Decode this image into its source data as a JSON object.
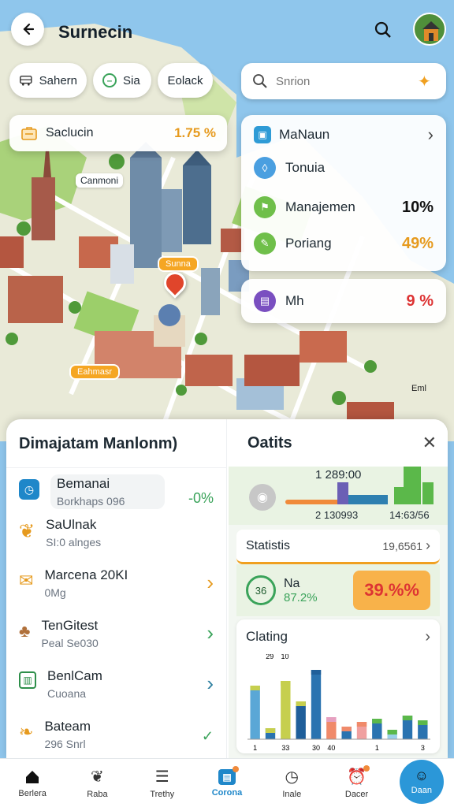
{
  "header": {
    "title": "Surnecin"
  },
  "filters": [
    {
      "label": "Sahern"
    },
    {
      "label": "Sia"
    },
    {
      "label": "Eolack"
    }
  ],
  "search": {
    "placeholder": "Snrion"
  },
  "stat_card": {
    "label": "Saclucin",
    "value": "1.75 %"
  },
  "map_labels": {
    "poi1": "Canmoni",
    "poi2": "Sunna",
    "poi3": "Eahmasr",
    "corner": "Eml"
  },
  "legend_panel": {
    "title": "MaNaun",
    "items": [
      {
        "label": "Tonuia",
        "value": "",
        "color": "#4a9fe0"
      },
      {
        "label": "Manajemen",
        "value": "10%",
        "color": "#6fbf4a"
      },
      {
        "label": "Poriang",
        "value": "49%",
        "color": "#6fbf4a"
      }
    ]
  },
  "mh_card": {
    "label": "Mh",
    "value": "9 %"
  },
  "sheet": {
    "title": "Dimajatam Manlonm)",
    "list": [
      {
        "title": "Bemanai",
        "subtitle": "Borkhaps 096",
        "trail": "-0%",
        "icon": "clock-icon"
      },
      {
        "title": "SaUlnak",
        "subtitle": "SI:0 alnges",
        "trail": "",
        "icon": "leaf-icon"
      },
      {
        "title": "Marcena 20KI",
        "subtitle": "0Mg",
        "trail": "›",
        "icon": "mail-icon"
      },
      {
        "title": "TenGitest",
        "subtitle": "Peal Se030",
        "trail": "›",
        "icon": "tree-icon"
      },
      {
        "title": "BenlCam",
        "subtitle": "Cuoana",
        "trail": "›",
        "icon": "doc-icon"
      },
      {
        "title": "Bateam",
        "subtitle": "296 Snrl",
        "trail": "✓",
        "icon": "leaf-icon"
      }
    ]
  },
  "stats_panel": {
    "title": "Oatits",
    "mini_top": "1 289:00",
    "mini_left": "2 130993",
    "mini_right": "14:63/56",
    "statistics_label": "Statistis",
    "statistics_value": "19,6561",
    "na_label": "Na",
    "na_badge": "36",
    "na_value": "87.2%",
    "big_value": "39.%%",
    "chart_title": "Clating",
    "chart_small_labels": [
      "29",
      "10"
    ]
  },
  "chart_data": {
    "type": "bar",
    "categories": [
      "1",
      "",
      "33",
      "",
      "30",
      "40",
      "",
      "",
      "1",
      "",
      "",
      "3"
    ],
    "series": [
      {
        "values": [
          68,
          14,
          74,
          48,
          88,
          28,
          16,
          22,
          26,
          12,
          30,
          24
        ],
        "color": "#5aa7d6"
      },
      {
        "values": [
          0,
          0,
          0,
          0,
          0,
          0,
          0,
          0,
          0,
          0,
          0,
          0
        ],
        "color": "#f0a070"
      }
    ],
    "ylim": [
      0,
      100
    ]
  },
  "nav": [
    {
      "label": "Berlera",
      "icon": "home-icon"
    },
    {
      "label": "Raba",
      "icon": "leaf-icon"
    },
    {
      "label": "Trethy",
      "icon": "list-icon"
    },
    {
      "label": "Corona",
      "icon": "bag-icon"
    },
    {
      "label": "Inale",
      "icon": "clock-icon"
    },
    {
      "label": "Dacer",
      "icon": "alarm-icon"
    },
    {
      "label": "Daan",
      "icon": "profile-icon"
    }
  ],
  "colors": {
    "accent": "#1f9ad6",
    "orange": "#f5a623",
    "green": "#3aa35a",
    "red": "#d33"
  }
}
